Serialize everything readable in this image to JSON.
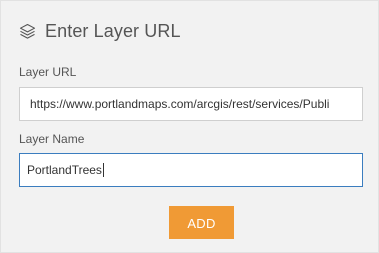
{
  "dialog": {
    "title": "Enter Layer URL",
    "icon": "layers-icon",
    "accent_color": "#f09a35",
    "focus_color": "#3b7dbf"
  },
  "form": {
    "url_label": "Layer URL",
    "url_value": "https://www.portlandmaps.com/arcgis/rest/services/Publi",
    "name_label": "Layer Name",
    "name_value": "PortlandTrees",
    "add_button_label": "ADD"
  }
}
